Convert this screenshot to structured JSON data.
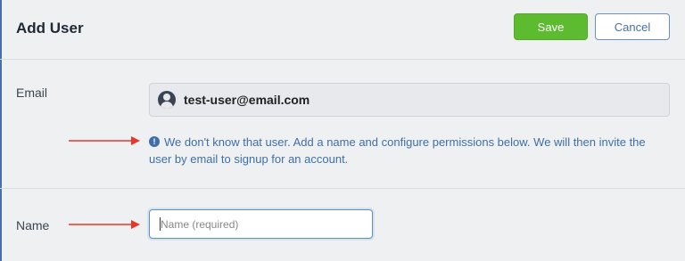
{
  "header": {
    "title": "Add User",
    "save_label": "Save",
    "cancel_label": "Cancel"
  },
  "email_section": {
    "label": "Email",
    "value": "test-user@email.com",
    "avatar_icon": "user-avatar-icon",
    "info_icon": "info-circle-icon",
    "info_message": "We don't know that user. Add a name and configure permissions below. We will then invite the user by email to signup for an account."
  },
  "name_section": {
    "label": "Name",
    "placeholder": "Name (required)",
    "value": ""
  },
  "colors": {
    "save_button": "#5cbb2e",
    "info_text": "#3f6fa8",
    "annotation_arrow": "#e8362a",
    "background": "#eef0f2"
  }
}
